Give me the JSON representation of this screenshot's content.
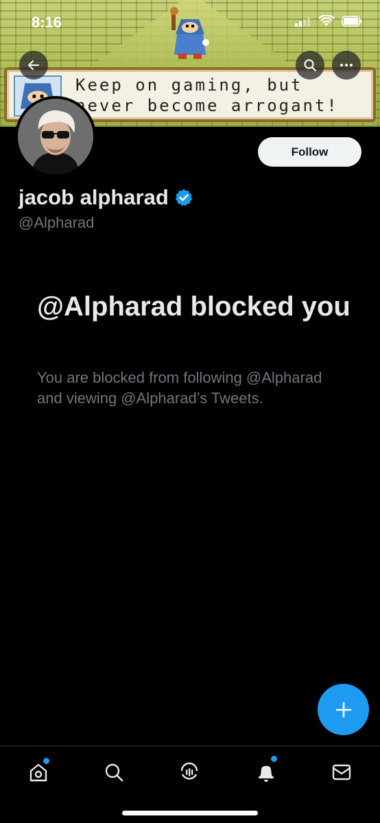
{
  "status_bar": {
    "time": "8:16"
  },
  "banner": {
    "dialog_line1": "Keep on gaming, but",
    "dialog_line2": "never become arrogant!"
  },
  "header": {
    "back_icon": "arrow-left-icon",
    "search_icon": "search-icon",
    "more_icon": "more-dots-icon"
  },
  "profile": {
    "name": "jacob alpharad",
    "handle": "@Alpharad",
    "follow_label": "Follow",
    "verified": true
  },
  "blocked": {
    "title": "@Alpharad blocked you",
    "body": "You are blocked from following @Alpharad and viewing @Alpharad’s Tweets."
  },
  "colors": {
    "accent": "#1d9bf0",
    "secondary_text": "#71767b",
    "primary_text": "#e7e9ea"
  },
  "tabbar": {
    "items": [
      "home-icon",
      "search-icon",
      "spaces-icon",
      "notifications-icon",
      "messages-icon"
    ]
  }
}
